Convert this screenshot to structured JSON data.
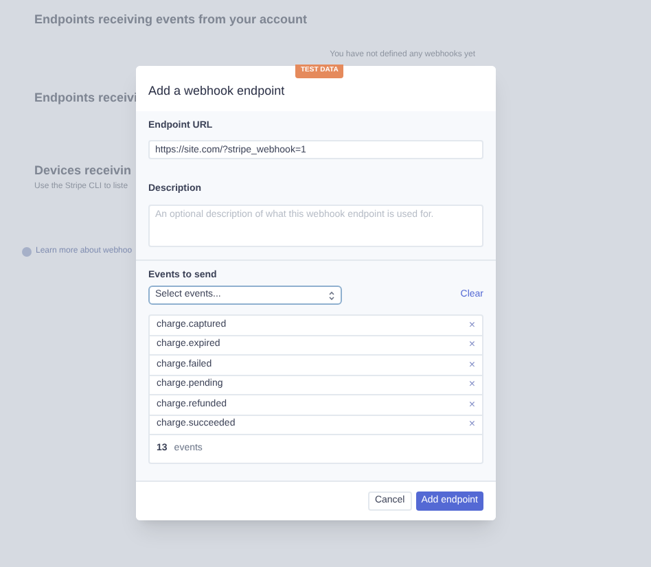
{
  "background": {
    "heading": "Endpoints receiving events from your account",
    "empty_note": "You have not defined any webhooks yet",
    "heading_2": "Endpoints receivi",
    "heading_3": "Devices receivin",
    "description_3": "Use the Stripe CLI to liste",
    "learn_more": "Learn more about webhoo"
  },
  "modal": {
    "badge": "TEST DATA",
    "title": "Add a webhook endpoint",
    "url_label": "Endpoint URL",
    "url_value": "https://site.com/?stripe_webhook=1",
    "description_label": "Description",
    "description_placeholder": "An optional description of what this webhook endpoint is used for.",
    "events_label": "Events to send",
    "events_select": "Select events...",
    "clear": "Clear",
    "events": [
      {
        "name": "charge.captured",
        "remove": "×"
      },
      {
        "name": "charge.expired",
        "remove": "×"
      },
      {
        "name": "charge.failed",
        "remove": "×"
      },
      {
        "name": "charge.pending",
        "remove": "×"
      },
      {
        "name": "charge.refunded",
        "remove": "×"
      },
      {
        "name": "charge.succeeded",
        "remove": "×"
      }
    ],
    "count": "13",
    "count_label": "events",
    "buttons": [
      {
        "label": "Cancel",
        "kind": "secondary"
      },
      {
        "label": "Add endpoint",
        "kind": "primary"
      }
    ]
  }
}
